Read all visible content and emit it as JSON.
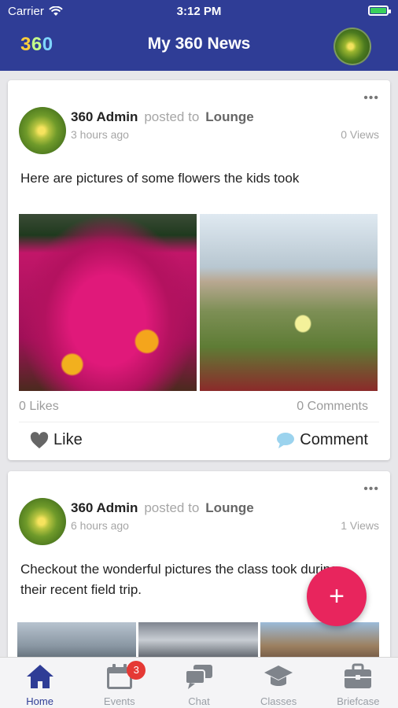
{
  "status_bar": {
    "carrier": "Carrier",
    "time": "3:12 PM"
  },
  "header": {
    "logo": [
      "3",
      "6",
      "0"
    ],
    "title": "My 360 News"
  },
  "posts": [
    {
      "author": "360 Admin",
      "posted_to_text": "posted to",
      "group": "Lounge",
      "time_ago": "3 hours ago",
      "views": "0 Views",
      "text": "Here are pictures of some flowers the kids took",
      "likes": "0 Likes",
      "comments": "0 Comments",
      "like_label": "Like",
      "comment_label": "Comment"
    },
    {
      "author": "360 Admin",
      "posted_to_text": "posted to",
      "group": "Lounge",
      "time_ago": "6 hours ago",
      "views": "1 Views",
      "text": "Checkout the wonderful pictures the class took during their recent field trip."
    }
  ],
  "fab": {
    "icon": "+"
  },
  "tabs": [
    {
      "label": "Home",
      "icon": "home-icon",
      "active": true
    },
    {
      "label": "Events",
      "icon": "calendar-icon",
      "badge": "3"
    },
    {
      "label": "Chat",
      "icon": "chat-icon"
    },
    {
      "label": "Classes",
      "icon": "graduation-cap-icon"
    },
    {
      "label": "Briefcase",
      "icon": "briefcase-icon"
    }
  ],
  "colors": {
    "primary": "#2f3d96",
    "fab": "#e8255d",
    "badge": "#e53935"
  }
}
